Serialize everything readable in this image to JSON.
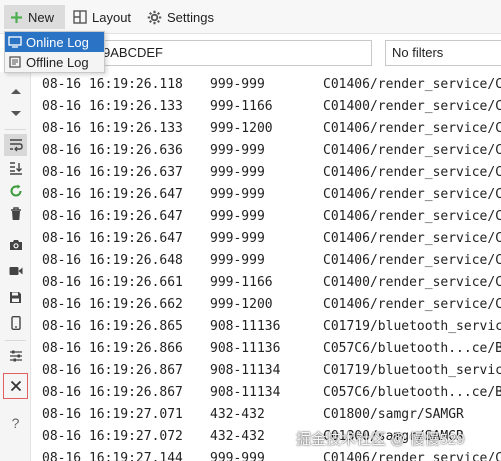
{
  "menubar": {
    "new_label": "New",
    "layout_label": "Layout",
    "settings_label": "Settings"
  },
  "new_menu": {
    "items": [
      {
        "label": "Online Log",
        "icon": "online-log-icon",
        "active": true
      },
      {
        "label": "Offline Log",
        "icon": "offline-log-icon",
        "active": false
      }
    ]
  },
  "filters": {
    "device_value": "9ABCDEF",
    "filter_value": "No filters"
  },
  "sidebar_icons": [
    "scroll-up-icon",
    "scroll-down-icon",
    "wrap-lines-icon",
    "scroll-to-end-icon",
    "restart-icon",
    "clear-icon",
    "screenshot-icon",
    "record-icon",
    "save-icon",
    "device-icon",
    "settings-sliders-icon",
    "close-icon",
    "help-icon"
  ],
  "log_rows": [
    {
      "time": "08-16 16:19:26.118",
      "pid": "999-999",
      "tag": "C01406/render_service/C"
    },
    {
      "time": "08-16 16:19:26.133",
      "pid": "999-1166",
      "tag": "C01400/render_service/C"
    },
    {
      "time": "08-16 16:19:26.133",
      "pid": "999-1200",
      "tag": "C01406/render_service/C"
    },
    {
      "time": "08-16 16:19:26.636",
      "pid": "999-999",
      "tag": "C01406/render_service/C"
    },
    {
      "time": "08-16 16:19:26.637",
      "pid": "999-999",
      "tag": "C01406/render_service/C"
    },
    {
      "time": "08-16 16:19:26.647",
      "pid": "999-999",
      "tag": "C01406/render_service/C"
    },
    {
      "time": "08-16 16:19:26.647",
      "pid": "999-999",
      "tag": "C01406/render_service/C"
    },
    {
      "time": "08-16 16:19:26.647",
      "pid": "999-999",
      "tag": "C01406/render_service/C"
    },
    {
      "time": "08-16 16:19:26.648",
      "pid": "999-999",
      "tag": "C01406/render_service/C"
    },
    {
      "time": "08-16 16:19:26.661",
      "pid": "999-1166",
      "tag": "C01400/render_service/C"
    },
    {
      "time": "08-16 16:19:26.662",
      "pid": "999-1200",
      "tag": "C01406/render_service/C"
    },
    {
      "time": "08-16 16:19:26.865",
      "pid": "908-11136",
      "tag": "C01719/bluetooth_servic"
    },
    {
      "time": "08-16 16:19:26.866",
      "pid": "908-11136",
      "tag": "C057C6/bluetooth...ce/B"
    },
    {
      "time": "08-16 16:19:26.867",
      "pid": "908-11134",
      "tag": "C01719/bluetooth_servic"
    },
    {
      "time": "08-16 16:19:26.867",
      "pid": "908-11134",
      "tag": "C057C6/bluetooth...ce/B"
    },
    {
      "time": "08-16 16:19:27.071",
      "pid": "432-432",
      "tag": "C01800/samgr/SAMGR"
    },
    {
      "time": "08-16 16:19:27.072",
      "pid": "432-432",
      "tag": "C01800/samgr/SAMGR"
    },
    {
      "time": "08-16 16:19:27.144",
      "pid": "999-999",
      "tag": "C01406/render_service/C"
    }
  ],
  "watermark": "掘金技术社区 @ 慢慢529"
}
